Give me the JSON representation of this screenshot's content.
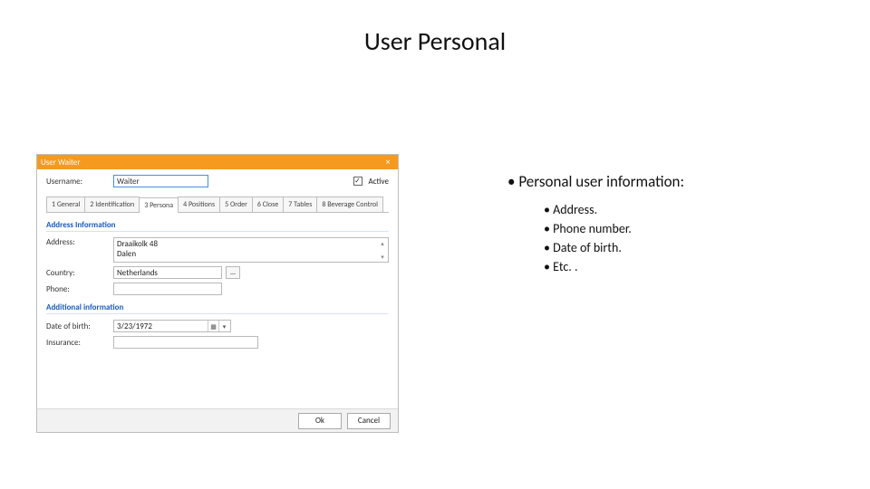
{
  "slide": {
    "title": "User Personal",
    "bullet_main": "Personal user information:",
    "sub_bullets": [
      "Address.",
      "Phone number.",
      "Date of birth.",
      "Etc. ."
    ]
  },
  "dialog": {
    "title": "User Waiter",
    "close_glyph": "×",
    "username_label": "Username:",
    "username_value": "Waiter",
    "active_check_glyph": "✓",
    "active_label": "Active",
    "tabs": [
      "1 General",
      "2 Identification",
      "3 Persona",
      "4 Positions",
      "5 Order",
      "6 Close",
      "7 Tables",
      "8 Beverage Control"
    ],
    "active_tab_index": 2,
    "section_address": "Address Information",
    "address_label": "Address:",
    "address_line1": "Draaikolk 48",
    "address_line2": "Dalen",
    "country_label": "Country:",
    "country_value": "Netherlands",
    "country_more": "...",
    "phone_label": "Phone:",
    "phone_value": "",
    "section_additional": "Additional information",
    "dob_label": "Date of birth:",
    "dob_value": "3/23/1972",
    "insurance_label": "Insurance:",
    "insurance_value": "",
    "ok_label": "Ok",
    "cancel_label": "Cancel"
  }
}
